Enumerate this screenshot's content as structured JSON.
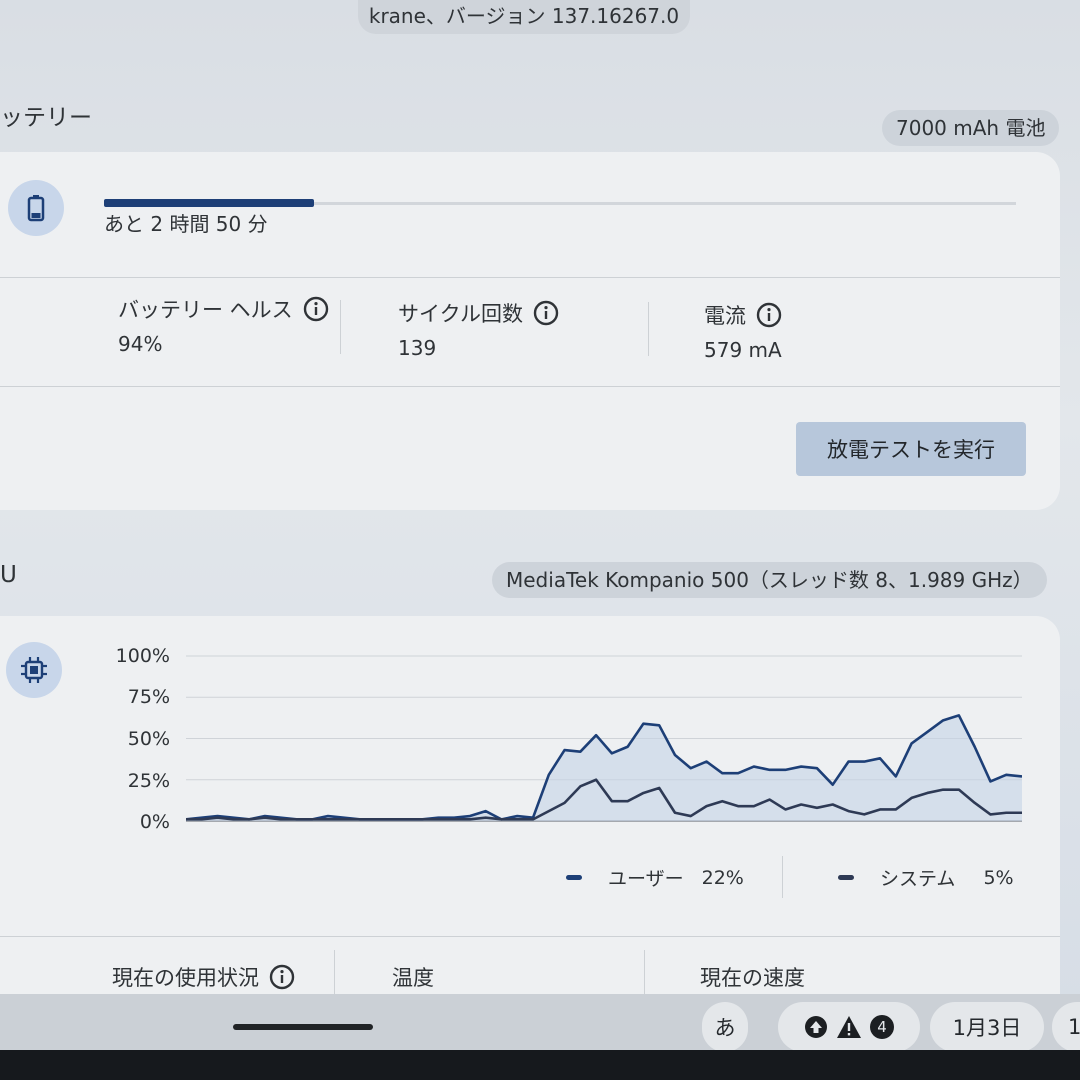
{
  "header": {
    "version_text": "krane、バージョン 137.16267.0"
  },
  "battery": {
    "section_title": "ッテリー",
    "capacity_pill": "7000 mAh 電池",
    "icon": "battery-icon",
    "charge_fraction": 0.23,
    "remaining_text": "あと 2 時間 50 分",
    "metrics": [
      {
        "label": "バッテリー ヘルス",
        "value": "94%"
      },
      {
        "label": "サイクル回数",
        "value": "139"
      },
      {
        "label": "電流",
        "value": "579 mA"
      }
    ],
    "discharge_button": "放電テストを実行"
  },
  "cpu": {
    "section_title": "U",
    "processor_pill": "MediaTek Kompanio 500（スレッド数 8、1.989 GHz）",
    "icon": "cpu-chip-icon",
    "legend": [
      {
        "label": "ユーザー",
        "value": "22%",
        "color": "#1d3f77"
      },
      {
        "label": "システム",
        "value": "5%",
        "color": "#2e3a55"
      }
    ],
    "bottom_labels": [
      "現在の使用状況",
      "温度",
      "現在の速度"
    ]
  },
  "chart_data": {
    "type": "area",
    "y_ticks": [
      "100%",
      "75%",
      "50%",
      "25%",
      "0%"
    ],
    "ylim": [
      0,
      100
    ],
    "grid": true,
    "series": [
      {
        "name": "ユーザー",
        "color": "#1d3f77",
        "values": [
          1,
          2,
          3,
          2,
          1,
          3,
          2,
          1,
          1,
          3,
          2,
          1,
          1,
          1,
          1,
          1,
          2,
          2,
          3,
          6,
          1,
          3,
          2,
          28,
          43,
          42,
          52,
          41,
          45,
          59,
          58,
          40,
          32,
          36,
          29,
          29,
          33,
          31,
          31,
          33,
          32,
          22,
          36,
          36,
          38,
          27,
          47,
          54,
          61,
          64,
          45,
          24,
          28,
          27
        ]
      },
      {
        "name": "システム",
        "color": "#2e3a55",
        "values": [
          1,
          1,
          2,
          1,
          1,
          2,
          1,
          1,
          1,
          1,
          1,
          1,
          1,
          1,
          1,
          1,
          1,
          1,
          1,
          2,
          1,
          1,
          1,
          6,
          11,
          21,
          25,
          12,
          12,
          17,
          20,
          5,
          3,
          9,
          12,
          9,
          9,
          13,
          7,
          10,
          8,
          10,
          6,
          4,
          7,
          7,
          14,
          17,
          19,
          19,
          11,
          4,
          5,
          5
        ]
      }
    ]
  },
  "shelf": {
    "ime_label": "あ",
    "notification_count": "4",
    "date_text": "1月3日",
    "overflow_text": "1"
  }
}
